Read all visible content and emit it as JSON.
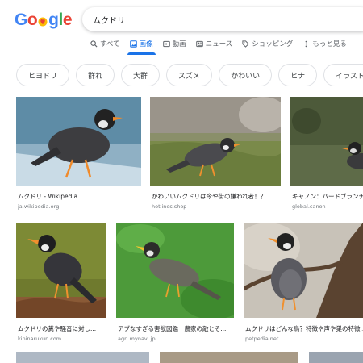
{
  "logo": {
    "text": "Google"
  },
  "search": {
    "query": "ムクドリ"
  },
  "tabs": [
    {
      "label": "すべて",
      "icon": "search-icon"
    },
    {
      "label": "画像",
      "icon": "image-icon"
    },
    {
      "label": "動画",
      "icon": "video-icon"
    },
    {
      "label": "ニュース",
      "icon": "news-icon"
    },
    {
      "label": "ショッピング",
      "icon": "tag-icon"
    },
    {
      "label": "もっと見る",
      "icon": "more-vert-icon"
    }
  ],
  "chips": [
    "ヒヨドリ",
    "群れ",
    "大群",
    "スズメ",
    "かわいい",
    "ヒナ",
    "イラスト"
  ],
  "results": [
    {
      "title": "ムクドリ - Wikipedia",
      "source": "ja.wikipedia.org"
    },
    {
      "title": "かわいいムクドリは今や街の嫌われ者！？...",
      "source": "hotlines.shop"
    },
    {
      "title": "キャノン：バードブランチ",
      "source": "global.canon"
    },
    {
      "title": "ムクドリの糞や騒音に対し...",
      "source": "kininarukun.com"
    },
    {
      "title": "アブなすぎる害獣図鑑｜農家の敵とそ...",
      "source": "agri.mynavi.jp"
    },
    {
      "title": "ムクドリはどんな鳥？特徴や声や巣の特徴...",
      "source": "petpedia.net"
    }
  ],
  "colors": {
    "accent": "#1a73e8",
    "chip_border": "#dfe1e5",
    "muted": "#70757a"
  }
}
